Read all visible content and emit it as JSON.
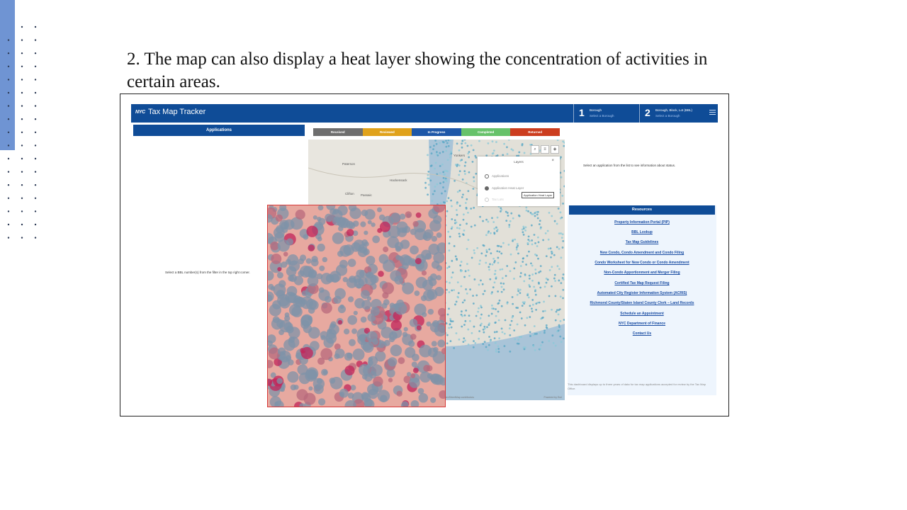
{
  "slide": {
    "title": "2.  The map can also display a heat layer showing the concentration of activities in certain areas."
  },
  "app": {
    "logo": "NYC",
    "title": "Tax Map Tracker",
    "steps": [
      {
        "number": "1",
        "label": "Borough",
        "sub": "Select a Borough"
      },
      {
        "number": "2",
        "label": "Borough, Block, Lot (BBL)",
        "sub": "Select a Borough"
      }
    ],
    "menu_icon": "hamburger-icon"
  },
  "left_panel": {
    "header": "Applications",
    "instruction": "Select a BBL number(s) from the filter in the top right corner."
  },
  "status_tabs": [
    {
      "label": "Received",
      "color": "#6e6e6e"
    },
    {
      "label": "Reviewed",
      "color": "#e0a21b"
    },
    {
      "label": "In Progress",
      "color": "#1d57a8"
    },
    {
      "label": "Completed",
      "color": "#66c26a"
    },
    {
      "label": "Returned",
      "color": "#cc3d1e"
    }
  ],
  "map": {
    "places": [
      "Paterson",
      "Yonkers",
      "Hackensack",
      "Clifton",
      "Passaic"
    ],
    "attribution_left": "OpenStreetMap contributors",
    "attribution_right": "Powered by Esri",
    "tools": [
      "zoom-icon",
      "list-icon",
      "layers-icon"
    ]
  },
  "layers_panel": {
    "title": "Layers",
    "close": "×",
    "items": [
      {
        "label": "Applications",
        "selected": false
      },
      {
        "label": "Application Heat Layer",
        "selected": true
      },
      {
        "label": "Tax Lots",
        "selected": false
      }
    ],
    "tooltip": "Application Heat Layer"
  },
  "right_panel": {
    "status_hint": "Select an application from the list to see information about status.",
    "resources_header": "Resources",
    "links": [
      "Property Information Portal (PIP)",
      "BBL Lookup",
      "Tax Map Guidelines",
      "New Condo, Condo Amendment and Condo Filing",
      "Condo Worksheet for New Condo or Condo Amendment",
      "Non-Condo Apportionment and Merger Filing",
      "Certified Tax Map Request Filing",
      "Automated City Register Information System (ACRIS)",
      "Richmond County/Staten Island County Clerk – Land Records",
      "Schedule an Appointment",
      "NYC Department of Finance",
      "Contact Us"
    ],
    "footnote": "This dashboard displays up to three years of data for tax map applications accepted for review by the Tax Map Office."
  }
}
